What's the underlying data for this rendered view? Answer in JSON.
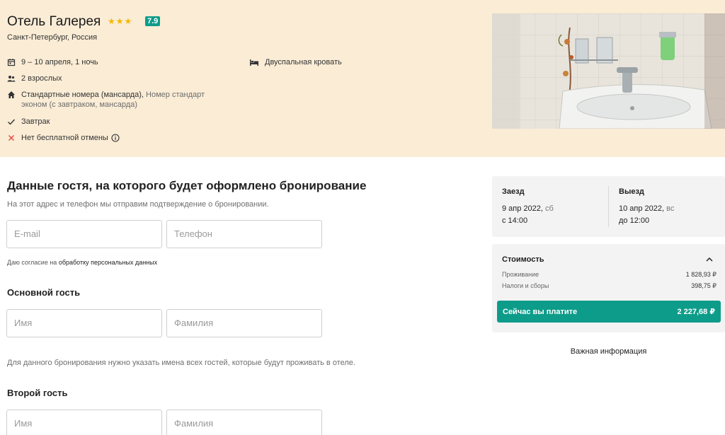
{
  "hotel": {
    "name": "Отель Галерея",
    "stars": "★★★",
    "rating": "7.9",
    "location": "Санкт-Петербург, Россия"
  },
  "details": {
    "dates": "9 – 10 апреля, 1 ночь",
    "guests": "2 взрослых",
    "room_main": "Стандартные номера (мансарда),",
    "room_extra_1": " Номер стандарт",
    "room_extra_2": "эконом (с завтраком, мансарда)",
    "breakfast": "Завтрак",
    "cancellation": "Нет бесплатной отмены",
    "bed": "Двуспальная кровать"
  },
  "form": {
    "heading": "Данные гостя, на которого будет оформлено бронирование",
    "subheading": "На этот адрес и телефон мы отправим подтверждение о бронировании.",
    "email_placeholder": "E-mail",
    "phone_placeholder": "Телефон",
    "consent_prefix": "Даю согласие на ",
    "consent_link": "обработку персональных данных",
    "main_guest_title": "Основной гость",
    "first_name_placeholder": "Имя",
    "last_name_placeholder": "Фамилия",
    "all_guests_note": "Для данного бронирования нужно указать имена всех гостей, которые будут проживать в отеле.",
    "second_guest_title": "Второй гость",
    "second_first_name_placeholder": "Имя",
    "second_last_name_placeholder": "Фамилия"
  },
  "stay": {
    "checkin_label": "Заезд",
    "checkin_date": "9 апр 2022,",
    "checkin_day": " сб",
    "checkin_time": "с 14:00",
    "checkout_label": "Выезд",
    "checkout_date": "10 апр 2022,",
    "checkout_day": " вс",
    "checkout_time": "до 12:00"
  },
  "cost": {
    "title": "Стоимость",
    "lines": [
      {
        "label": "Проживание",
        "value": "1 828,93 ₽"
      },
      {
        "label": "Налоги и сборы",
        "value": "398,75 ₽"
      }
    ],
    "pay_now_label": "Сейчас вы платите",
    "pay_now_value": "2 227,68 ₽"
  },
  "important_info": "Важная информация",
  "colors": {
    "accent": "#0e9c8a",
    "header_bg": "#faecd5",
    "star": "#f5b800",
    "cancel_x": "#e0473c"
  },
  "icons": [
    "calendar-icon",
    "people-icon",
    "home-icon",
    "check-icon",
    "close-icon",
    "info-icon",
    "bed-icon",
    "chevron-up-icon"
  ]
}
